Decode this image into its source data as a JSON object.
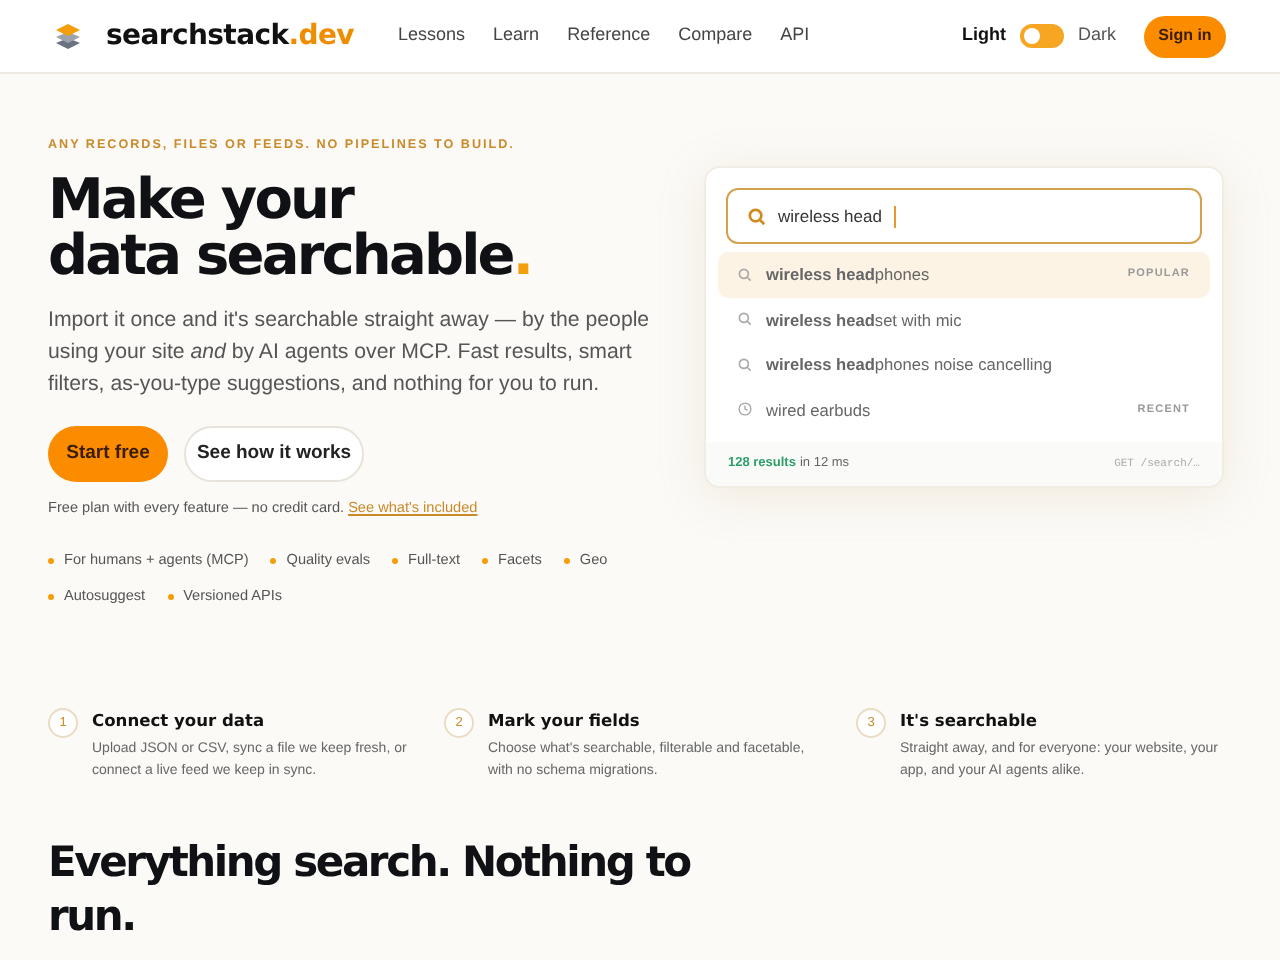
{
  "header": {
    "brand": "searchstack",
    "brand_suffix": ".dev",
    "nav": [
      "Lessons",
      "Learn",
      "Reference",
      "Compare",
      "API"
    ],
    "theme": [
      {
        "label": "Light",
        "selected": true
      },
      {
        "label": "Dark",
        "selected": false
      }
    ],
    "sign_in": "Sign in"
  },
  "hero": {
    "eyebrow": "ANY RECORDS, FILES OR FEEDS. NO PIPELINES TO BUILD.",
    "headline_lines": [
      "Make your",
      "data searchable"
    ],
    "headline_accent": ".",
    "intro": "Import it once and it's searchable straight away — by the people using your site *and* by AI agents over MCP. Fast results, smart filters, as-you-type suggestions, and nothing for you to run.",
    "buttons": [
      {
        "label": "Start free",
        "kind": "primary"
      },
      {
        "label": "See how it works",
        "kind": "secondary"
      }
    ],
    "note": "Free plan with every feature — no credit card.",
    "note_link": "See what's included",
    "features": [
      "For humans + agents (MCP)",
      "Quality evals",
      "Full-text",
      "Facets",
      "Geo",
      "Autosuggest",
      "Versioned APIs"
    ]
  },
  "search_demo": {
    "query": "wireless head",
    "suggestions": [
      {
        "kind": "search",
        "text": "**wireless head**phones",
        "badge": "POPULAR",
        "selected": true
      },
      {
        "kind": "search",
        "text": "**wireless head**set with mic",
        "selected": false
      },
      {
        "kind": "search",
        "text": "**wireless head**phones noise cancelling",
        "selected": false
      },
      {
        "kind": "recent",
        "text": "wired earbuds",
        "badge": "RECENT",
        "selected": false
      }
    ],
    "result_count": "128 results",
    "timing": "in 12 ms",
    "endpoint": "GET /search/…"
  },
  "steps": [
    {
      "number": "1",
      "title": "Connect your data",
      "text": "Upload JSON or CSV, sync a file we keep fresh, or connect a live feed we keep in sync."
    },
    {
      "number": "2",
      "title": "Mark your fields",
      "text": "Choose what's searchable, filterable and facetable, with no schema migrations."
    },
    {
      "number": "3",
      "title": "It's searchable",
      "text": "Straight away, and for everyone: your website, your app, and your AI agents alike."
    }
  ],
  "section_heading": "Everything search. Nothing to run."
}
